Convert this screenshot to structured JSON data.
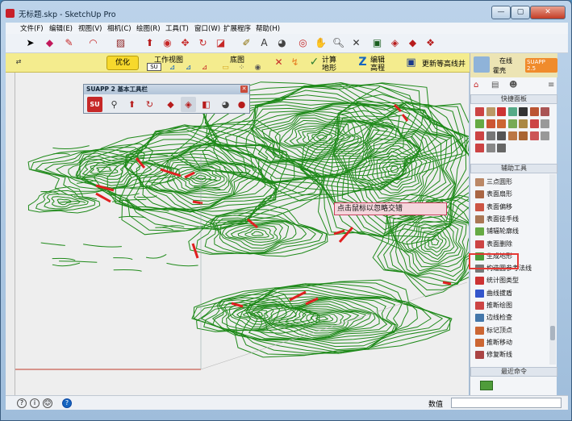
{
  "window": {
    "title": "无标题.skp - SketchUp Pro",
    "minimize": "—",
    "maximize": "▢",
    "close": "✕"
  },
  "menu": [
    "文件(F)",
    "编辑(E)",
    "视图(V)",
    "相机(C)",
    "绘图(R)",
    "工具(T)",
    "窗口(W)",
    "扩展程序",
    "帮助(H)"
  ],
  "toolbar2": {
    "optimize": "优化",
    "work_view": "工作视图",
    "work_view_sub": "SU",
    "base_map": "底图",
    "compute_terrain": [
      "计算",
      "地形"
    ],
    "edit_elevation": [
      "编辑",
      "高程"
    ],
    "update_contours": "更新等高线并"
  },
  "suapp": {
    "title": "SUAPP 2 基本工具栏",
    "logo": "SU"
  },
  "tooltip": "点击鼠标以忽略交错",
  "right_panel": {
    "online": "在线",
    "user": "霍壳",
    "brand": "SUAPP 2.5",
    "quick_panel": "快捷面板",
    "aux_tools": "辅助工具",
    "items": [
      "三点圆形",
      "表面扇形",
      "表面偏移",
      "表面徒手线",
      "铺辐轮廓线",
      "表面删除",
      "生成地形",
      "构造圆参考法线",
      "统计图类型",
      "曲线拔盾",
      "推断绘图",
      "边线检查",
      "标记顶点",
      "推断移动",
      "修复断线"
    ],
    "recent": "最近命令"
  },
  "status": {
    "value_label": "数值"
  },
  "colors": {
    "contour": "#1f8a1a",
    "conflict": "#e02020",
    "highlight": "#e53935"
  }
}
